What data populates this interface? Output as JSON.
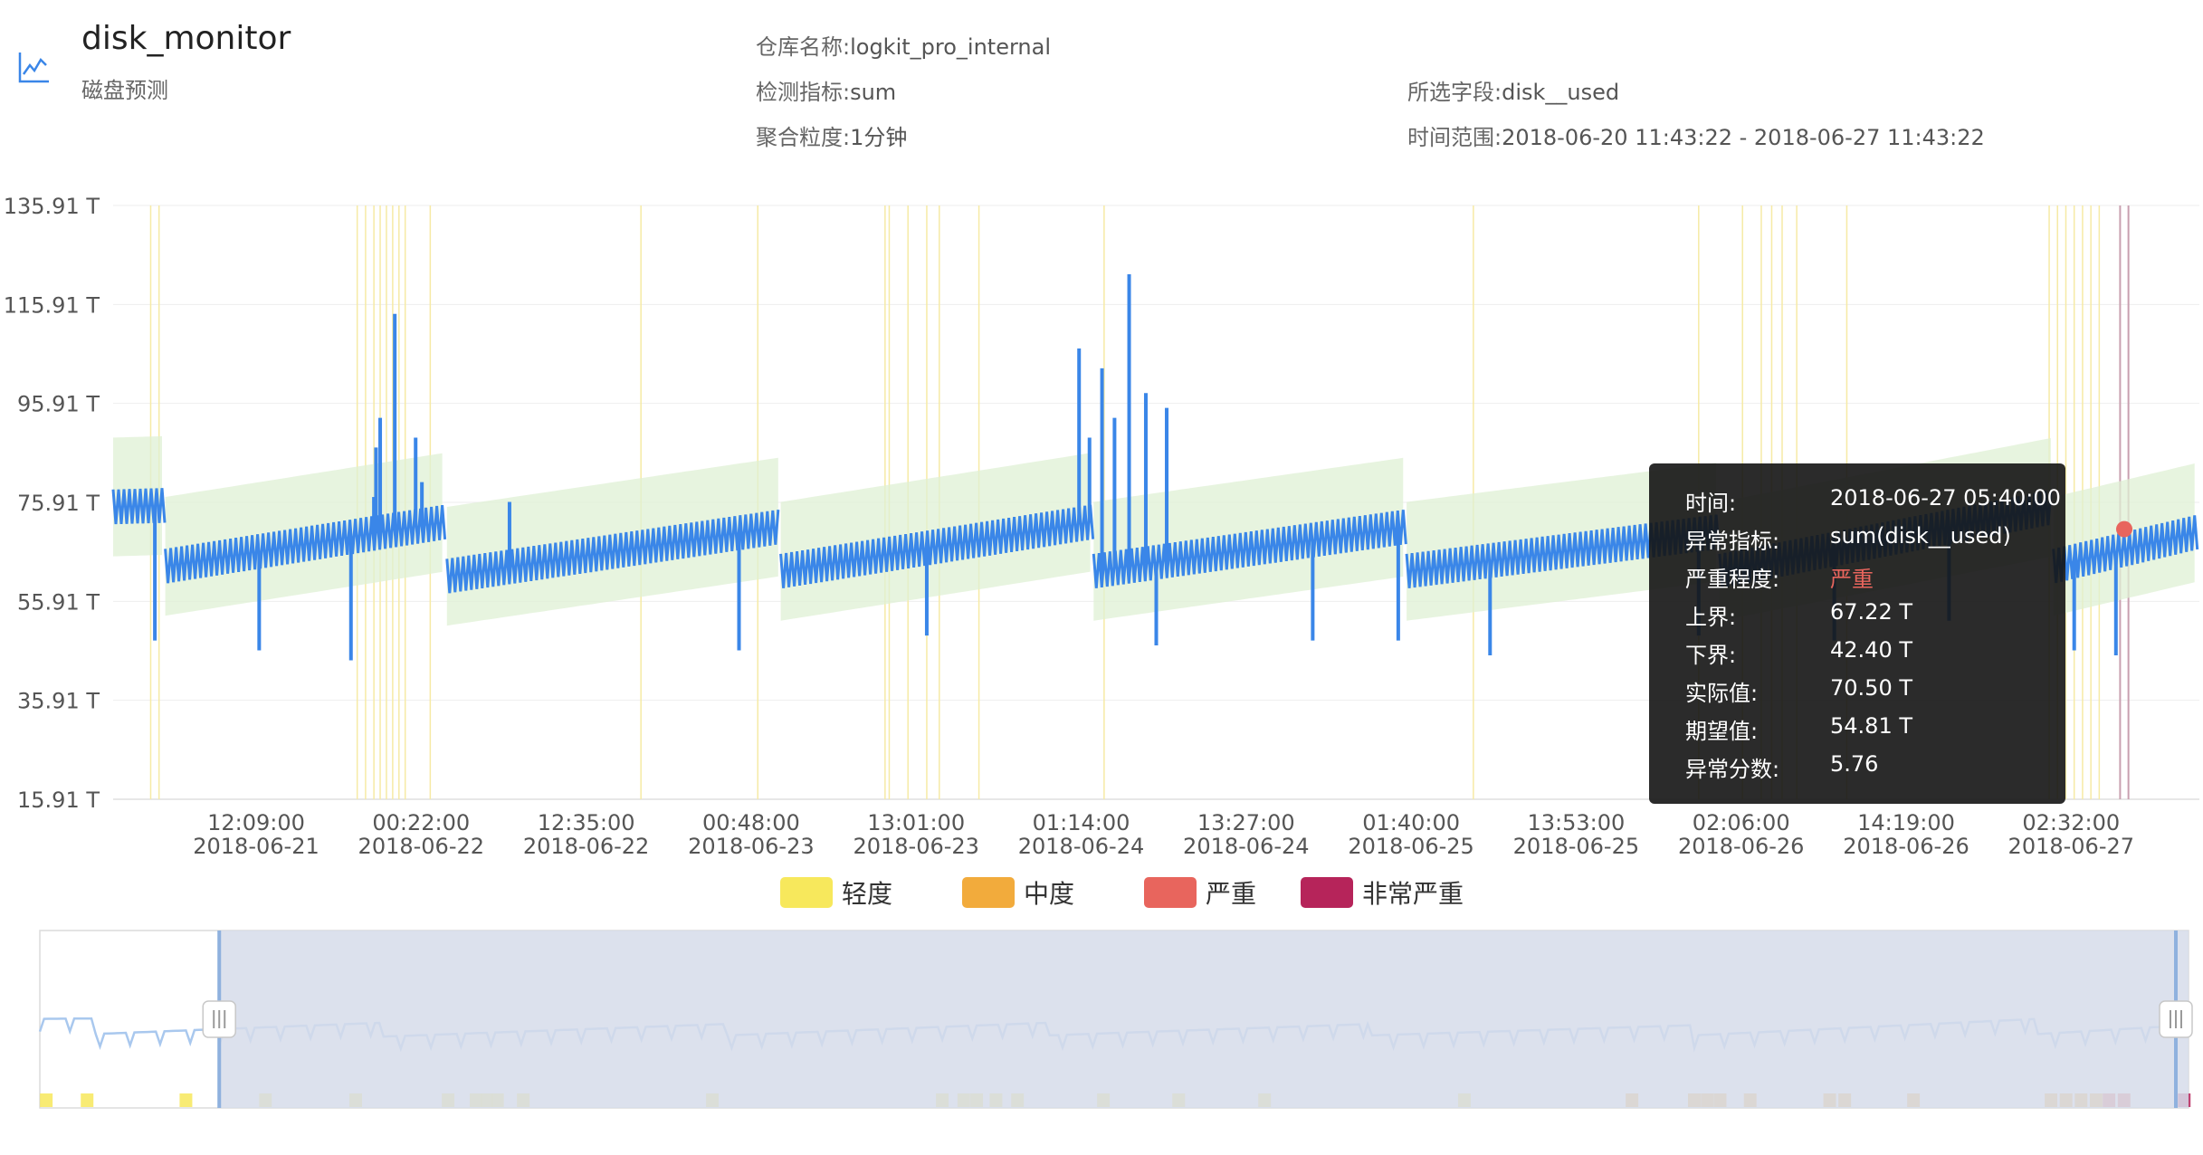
{
  "header": {
    "icon": "line-chart-icon",
    "title": "disk_monitor",
    "subtitle": "磁盘预测",
    "repo_label": "仓库名称:",
    "repo_value": "logkit_pro_internal",
    "metric_label": "检测指标:",
    "metric_value": "sum",
    "agg_label": "聚合粒度:",
    "agg_value": "1分钟",
    "field_label": "所选字段:",
    "field_value": "disk__used",
    "range_label": "时间范围:",
    "range_value": "2018-06-20 11:43:22 - 2018-06-27 11:43:22"
  },
  "chart_data": {
    "type": "line",
    "title": "",
    "xlabel": "",
    "ylabel": "",
    "y_ticks": [
      "135.91 T",
      "115.91 T",
      "95.91 T",
      "75.91 T",
      "55.91 T",
      "35.91 T",
      "15.91 T"
    ],
    "ylim": [
      15.91,
      135.91
    ],
    "x_ticks": [
      {
        "time": "12:09:00",
        "date": "2018-06-21"
      },
      {
        "time": "00:22:00",
        "date": "2018-06-22"
      },
      {
        "time": "12:35:00",
        "date": "2018-06-22"
      },
      {
        "time": "00:48:00",
        "date": "2018-06-23"
      },
      {
        "time": "13:01:00",
        "date": "2018-06-23"
      },
      {
        "time": "01:14:00",
        "date": "2018-06-24"
      },
      {
        "time": "13:27:00",
        "date": "2018-06-24"
      },
      {
        "time": "01:40:00",
        "date": "2018-06-25"
      },
      {
        "time": "13:53:00",
        "date": "2018-06-25"
      },
      {
        "time": "02:06:00",
        "date": "2018-06-26"
      },
      {
        "time": "14:19:00",
        "date": "2018-06-26"
      },
      {
        "time": "02:32:00",
        "date": "2018-06-27"
      }
    ],
    "series": [
      {
        "color": "#3a86e8",
        "segments": [
          {
            "start": 0.0,
            "end": 0.025,
            "y0": 75.0,
            "y1": 75.3
          },
          {
            "start": 0.025,
            "end": 0.16,
            "y0": 63.0,
            "y1": 72.0
          },
          {
            "start": 0.16,
            "end": 0.32,
            "y0": 61.0,
            "y1": 71.0
          },
          {
            "start": 0.32,
            "end": 0.47,
            "y0": 62.0,
            "y1": 72.0
          },
          {
            "start": 0.47,
            "end": 0.62,
            "y0": 62.0,
            "y1": 71.0
          },
          {
            "start": 0.62,
            "end": 0.77,
            "y0": 62.0,
            "y1": 70.0
          },
          {
            "start": 0.77,
            "end": 0.93,
            "y0": 62.0,
            "y1": 75.0
          },
          {
            "start": 0.93,
            "end": 1.0,
            "y0": 63.0,
            "y1": 70.0
          }
        ],
        "spikes_up": [
          {
            "pos": 0.125,
            "y": 77.0
          },
          {
            "pos": 0.126,
            "y": 87.0
          },
          {
            "pos": 0.128,
            "y": 93.0
          },
          {
            "pos": 0.135,
            "y": 114.0
          },
          {
            "pos": 0.145,
            "y": 89.0
          },
          {
            "pos": 0.148,
            "y": 80.0
          },
          {
            "pos": 0.463,
            "y": 107.0
          },
          {
            "pos": 0.468,
            "y": 89.0
          },
          {
            "pos": 0.474,
            "y": 103.0
          },
          {
            "pos": 0.48,
            "y": 93.0
          },
          {
            "pos": 0.487,
            "y": 122.0
          },
          {
            "pos": 0.495,
            "y": 98.0
          },
          {
            "pos": 0.505,
            "y": 95.0
          },
          {
            "pos": 0.19,
            "y": 76.0
          }
        ],
        "spikes_down": [
          {
            "pos": 0.02,
            "y": 48.0
          },
          {
            "pos": 0.07,
            "y": 46.0
          },
          {
            "pos": 0.114,
            "y": 44.0
          },
          {
            "pos": 0.3,
            "y": 46.0
          },
          {
            "pos": 0.39,
            "y": 49.0
          },
          {
            "pos": 0.5,
            "y": 47.0
          },
          {
            "pos": 0.575,
            "y": 48.0
          },
          {
            "pos": 0.616,
            "y": 48.0
          },
          {
            "pos": 0.66,
            "y": 45.0
          },
          {
            "pos": 0.76,
            "y": 49.0
          },
          {
            "pos": 0.825,
            "y": 48.0
          },
          {
            "pos": 0.88,
            "y": 52.0
          },
          {
            "pos": 0.94,
            "y": 46.0
          },
          {
            "pos": 0.96,
            "y": 45.0
          }
        ],
        "band": {
          "color": "#dff0d4",
          "upper_offset": 14.0,
          "lower_offset": -10.0
        }
      }
    ],
    "anomaly_lines": {
      "color": "#f6eaa5",
      "positions": [
        0.018,
        0.022,
        0.117,
        0.121,
        0.125,
        0.128,
        0.131,
        0.134,
        0.137,
        0.14,
        0.152,
        0.253,
        0.309,
        0.37,
        0.372,
        0.381,
        0.39,
        0.396,
        0.415,
        0.475,
        0.652,
        0.76,
        0.781,
        0.79,
        0.795,
        0.8,
        0.807,
        0.831,
        0.928,
        0.932,
        0.936,
        0.94,
        0.944,
        0.948,
        0.952
      ]
    },
    "severe_lines": {
      "color": "#c9a0b0",
      "positions": [
        0.962,
        0.966
      ]
    },
    "highlight_point": {
      "pos": 0.964,
      "y": 70.5,
      "color": "#e8655d"
    },
    "tooltip": {
      "time_label": "时间:",
      "time_value": "2018-06-27 05:40:00",
      "metric_label": "异常指标:",
      "metric_value": "sum(disk__used)",
      "severity_label": "严重程度:",
      "severity_value": "严重",
      "severity_color": "#e8655d",
      "upper_label": "上界:",
      "upper_value": "67.22 T",
      "lower_label": "下界:",
      "lower_value": "42.40 T",
      "actual_label": "实际值:",
      "actual_value": "70.50 T",
      "expected_label": "期望值:",
      "expected_value": "54.81 T",
      "score_label": "异常分数:",
      "score_value": "5.76"
    },
    "legend": [
      {
        "label": "轻度",
        "color": "#f7e85c"
      },
      {
        "label": "中度",
        "color": "#f2ab3c"
      },
      {
        "label": "严重",
        "color": "#e8655d"
      },
      {
        "label": "非常严重",
        "color": "#b6245a"
      }
    ],
    "zoom": {
      "window_start": 0.0,
      "window_end": 0.0835,
      "mask_color": "#d6dcea",
      "markers": [
        {
          "pos": 0.003,
          "level": 0
        },
        {
          "pos": 0.022,
          "level": 0
        },
        {
          "pos": 0.068,
          "level": 0
        },
        {
          "pos": 0.105,
          "level": 0
        },
        {
          "pos": 0.147,
          "level": 0
        },
        {
          "pos": 0.19,
          "level": 0
        },
        {
          "pos": 0.203,
          "level": 0
        },
        {
          "pos": 0.208,
          "level": 0
        },
        {
          "pos": 0.213,
          "level": 0
        },
        {
          "pos": 0.225,
          "level": 0
        },
        {
          "pos": 0.313,
          "level": 0
        },
        {
          "pos": 0.42,
          "level": 0
        },
        {
          "pos": 0.43,
          "level": 0
        },
        {
          "pos": 0.436,
          "level": 0
        },
        {
          "pos": 0.445,
          "level": 0
        },
        {
          "pos": 0.455,
          "level": 0
        },
        {
          "pos": 0.495,
          "level": 0
        },
        {
          "pos": 0.53,
          "level": 0
        },
        {
          "pos": 0.57,
          "level": 0
        },
        {
          "pos": 0.663,
          "level": 0
        },
        {
          "pos": 0.741,
          "level": 1
        },
        {
          "pos": 0.77,
          "level": 1
        },
        {
          "pos": 0.776,
          "level": 1
        },
        {
          "pos": 0.782,
          "level": 1
        },
        {
          "pos": 0.796,
          "level": 1
        },
        {
          "pos": 0.833,
          "level": 1
        },
        {
          "pos": 0.84,
          "level": 1
        },
        {
          "pos": 0.872,
          "level": 1
        },
        {
          "pos": 0.936,
          "level": 1
        },
        {
          "pos": 0.943,
          "level": 1
        },
        {
          "pos": 0.95,
          "level": 1
        },
        {
          "pos": 0.957,
          "level": 1
        },
        {
          "pos": 0.963,
          "level": 2
        },
        {
          "pos": 0.97,
          "level": 2
        },
        {
          "pos": 0.998,
          "level": 3
        }
      ]
    }
  }
}
